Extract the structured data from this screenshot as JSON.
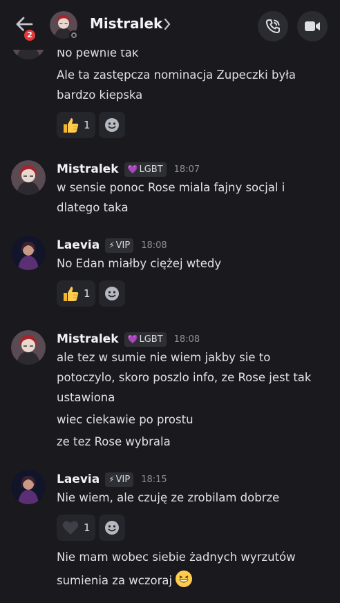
{
  "header": {
    "name": "Mistralek",
    "unread_badge": "2"
  },
  "messages": [
    {
      "lines": [
        "No pewnie tak",
        "Ale ta zastępcza nominacja Zupeczki była",
        "bardzo kiepska"
      ],
      "reaction": {
        "emoji": "thumbs-up",
        "count": "1"
      }
    },
    {
      "author": "Mistralek",
      "tag_icon": "💜",
      "tag": "LGBT",
      "time": "18:07",
      "lines": [
        "w sensie ponoc Rose miala fajny socjal i",
        "dlatego taka"
      ]
    },
    {
      "author": "Laevia",
      "tag_icon": "⚡",
      "tag": "VIP",
      "time": "18:08",
      "lines": [
        "No Edan miałby ciężej wtedy"
      ],
      "reaction": {
        "emoji": "thumbs-up",
        "count": "1"
      }
    },
    {
      "author": "Mistralek",
      "tag_icon": "💜",
      "tag": "LGBT",
      "time": "18:08",
      "lines": [
        "ale tez w sumie nie wiem jakby sie to",
        "potoczylo, skoro poszlo info, ze Rose jest tak",
        "ustawiona",
        "wiec ciekawie po prostu",
        "ze tez Rose wybrala"
      ]
    },
    {
      "author": "Laevia",
      "tag_icon": "⚡",
      "tag": "VIP",
      "time": "18:15",
      "lines": [
        "Nie wiem, ale czuję ze zrobilam dobrze",
        "Nie mam wobec siebie żadnych wyrzutów",
        "sumienia za wczoraj"
      ],
      "reaction": {
        "emoji": "heart",
        "count": "1"
      }
    }
  ],
  "colors": {
    "background": "#1a1a1e",
    "text": "#dfe0e4",
    "badge": "#e5393b",
    "tag_bg": "#2e2f35",
    "reaction_bg": "#25262b"
  }
}
